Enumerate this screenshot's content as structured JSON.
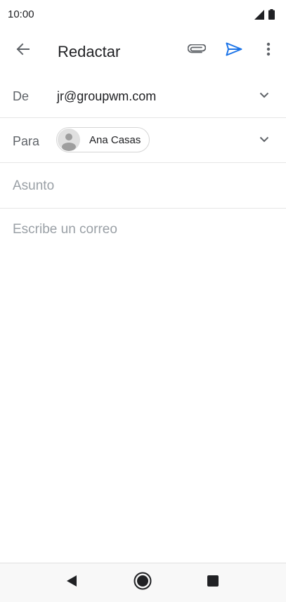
{
  "status": {
    "time": "10:00"
  },
  "header": {
    "title": "Redactar"
  },
  "form": {
    "from_label": "De",
    "from_value": "jr@groupwm.com",
    "to_label": "Para",
    "to_recipient": "Ana Casas",
    "subject_placeholder": "Asunto",
    "body_placeholder": "Escribe un correo"
  },
  "colors": {
    "accent": "#1a73e8",
    "icon": "#5f6368"
  },
  "icons": [
    "signal-icon",
    "battery-icon",
    "back-arrow-icon",
    "attach-icon",
    "send-icon",
    "more-vert-icon",
    "chevron-down-icon",
    "avatar-icon",
    "nav-back-icon",
    "nav-home-icon",
    "nav-recents-icon"
  ]
}
